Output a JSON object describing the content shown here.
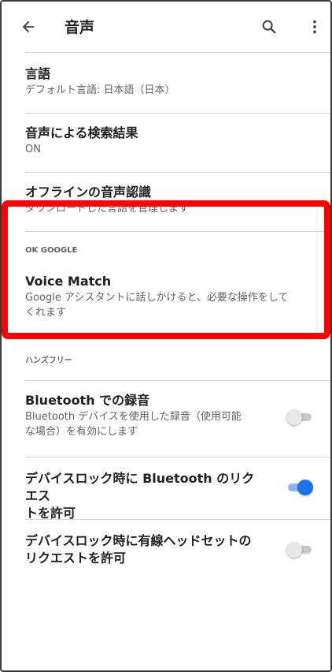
{
  "appbar": {
    "title": "音声"
  },
  "items": [
    {
      "title": "言語",
      "summary": "デフォルト言語: 日本語（日本）"
    },
    {
      "title": "音声による検索結果",
      "summary": "ON"
    },
    {
      "title": "オフラインの音声認識",
      "summary": "ダウンロードした言語を管理します"
    }
  ],
  "section_ok_google": "OK GOOGLE",
  "voice_match": {
    "title": "Voice Match",
    "summary_line1": "Google アシスタントに話しかけると、必要な操作をして",
    "summary_line2": "くれます"
  },
  "section_handsfree": "ハンズフリー",
  "bluetooth_record": {
    "title": "Bluetooth での録音",
    "summary_line1": "Bluetooth デバイスを使用した録音（使用可能",
    "summary_line2": "な場合）を有効にします",
    "enabled": false
  },
  "lock_bluetooth": {
    "title_line1": "デバイスロック時に Bluetooth のリクエス",
    "title_line2": "トを許可",
    "enabled": true
  },
  "lock_wired": {
    "title_line1": "デバイスロック時に有線ヘッドセットの",
    "title_line2": "リクエストを許可",
    "enabled": false
  },
  "colors": {
    "accent": "#1a73e8",
    "highlight": "#ff0000"
  },
  "icons": [
    "back-arrow-icon",
    "search-icon",
    "more-vert-icon"
  ]
}
